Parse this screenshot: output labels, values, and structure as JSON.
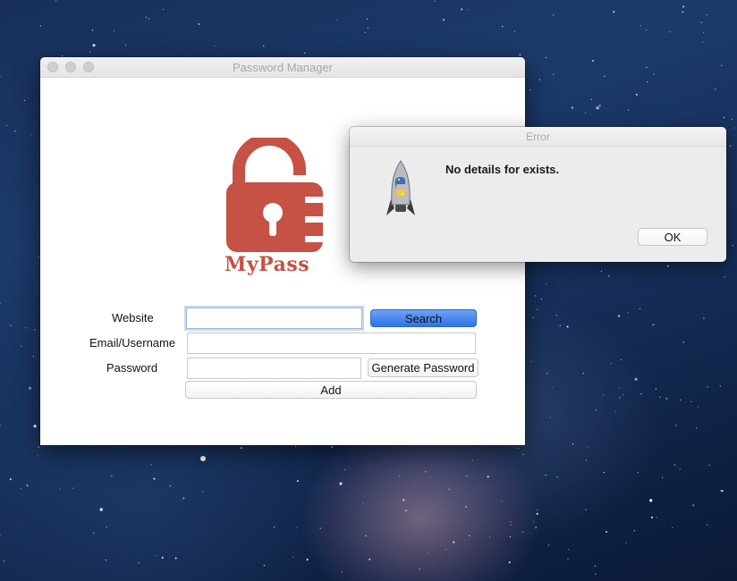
{
  "window": {
    "title": "Password Manager"
  },
  "logo": {
    "text": "MyPass",
    "color": "#c65145"
  },
  "form": {
    "website_label": "Website",
    "website_value": "",
    "email_label": "Email/Username",
    "email_value": "",
    "password_label": "Password",
    "password_value": "",
    "search_button": "Search",
    "generate_button": "Generate Password",
    "add_button": "Add"
  },
  "dialog": {
    "title": "Error",
    "message": "No details for  exists.",
    "ok_button": "OK",
    "icon": "python-rocket-icon"
  },
  "colors": {
    "accent": "#3a7ff0",
    "focus": "#9bb8da"
  }
}
